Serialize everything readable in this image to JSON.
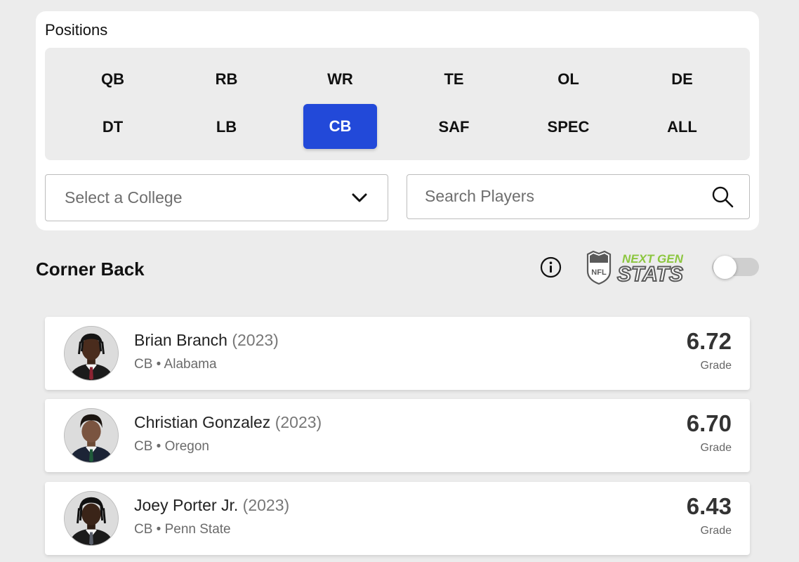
{
  "filters": {
    "positions_title": "Positions",
    "positions": [
      {
        "label": "QB",
        "active": false
      },
      {
        "label": "RB",
        "active": false
      },
      {
        "label": "WR",
        "active": false
      },
      {
        "label": "TE",
        "active": false
      },
      {
        "label": "OL",
        "active": false
      },
      {
        "label": "DE",
        "active": false
      },
      {
        "label": "DT",
        "active": false
      },
      {
        "label": "LB",
        "active": false
      },
      {
        "label": "CB",
        "active": true
      },
      {
        "label": "SAF",
        "active": false
      },
      {
        "label": "SPEC",
        "active": false
      },
      {
        "label": "ALL",
        "active": false
      }
    ],
    "college_select": {
      "value": "Select a College",
      "icon": "chevron-down-icon"
    },
    "search": {
      "placeholder": "Search Players",
      "value": "",
      "icon": "search-icon"
    }
  },
  "section": {
    "title": "Corner Back",
    "info_icon": "info-icon",
    "logo": {
      "line1": "NEXT GEN",
      "line2": "STATS",
      "shield": "NFL"
    },
    "toggle": {
      "on": false
    }
  },
  "players": [
    {
      "name": "Brian Branch",
      "year": "(2023)",
      "meta": "CB • Alabama",
      "grade": "6.72",
      "grade_label": "Grade",
      "tie": "#8b2332"
    },
    {
      "name": "Christian Gonzalez",
      "year": "(2023)",
      "meta": "CB • Oregon",
      "grade": "6.70",
      "grade_label": "Grade",
      "tie": "#1f5a3a"
    },
    {
      "name": "Joey Porter Jr.",
      "year": "(2023)",
      "meta": "CB • Penn State",
      "grade": "6.43",
      "grade_label": "Grade",
      "tie": "#5a5f6b"
    }
  ],
  "colors": {
    "accent": "#2249d9",
    "logo_green": "#8cc63f",
    "logo_gray": "#5a5a5a"
  }
}
